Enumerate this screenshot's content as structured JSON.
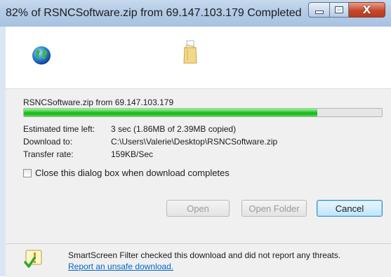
{
  "window": {
    "title": "82% of RSNCSoftware.zip from 69.147.103.179 Completed",
    "buttons": {
      "minimize_icon": "minimize-icon",
      "maximize_icon": "maximize-icon",
      "close_icon": "close-icon",
      "close_glyph": "X"
    }
  },
  "animation": {
    "source_icon": "globe-icon",
    "destination_icon": "folder-icon"
  },
  "download": {
    "file_from": "RSNCSoftware.zip from 69.147.103.179",
    "progress_percent": 82,
    "estimated_label": "Estimated time left:",
    "estimated_value": "3 sec (1.86MB of 2.39MB copied)",
    "download_to_label": "Download to:",
    "download_to_value": "C:\\Users\\Valerie\\Desktop\\RSNCSoftware.zip",
    "transfer_label": "Transfer rate:",
    "transfer_value": "159KB/Sec",
    "close_when_done_label": "Close this dialog box when download completes",
    "close_when_done_checked": false
  },
  "actions": {
    "open_label": "Open",
    "open_folder_label": "Open Folder",
    "cancel_label": "Cancel"
  },
  "smartscreen": {
    "icon": "smartscreen-shield-icon",
    "message": "SmartScreen Filter checked this download and did not report any threats.",
    "link": "Report an unsafe download."
  },
  "colors": {
    "progress": "#22bb22",
    "link": "#0066cc",
    "close_button": "#c4492c"
  }
}
